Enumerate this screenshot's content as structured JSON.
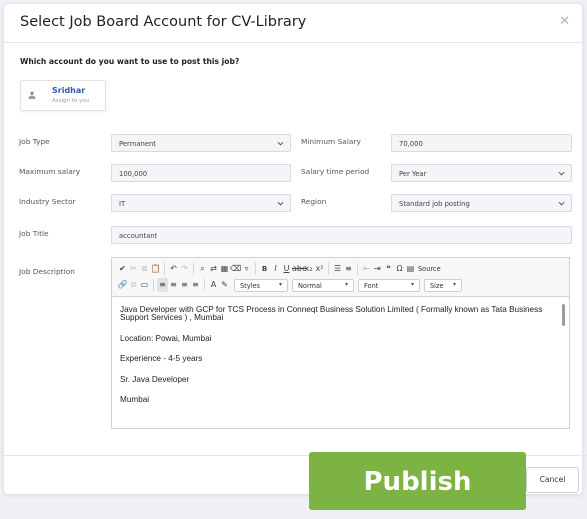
{
  "modal": {
    "title": "Select Job Board Account for CV-Library",
    "close_icon": "close-icon"
  },
  "account_question": "Which account do you want to use to post this job?",
  "account": {
    "name": "Sridhar",
    "subtitle": "Assign to you",
    "icon": "person-icon"
  },
  "form": {
    "job_type": {
      "label": "Job Type",
      "value": "Permanent"
    },
    "minimum_salary": {
      "label": "Minimum Salary",
      "value": "70,000"
    },
    "maximum_salary": {
      "label": "Maximum salary",
      "value": "100,000"
    },
    "salary_time_period": {
      "label": "Salary time period",
      "value": "Per Year"
    },
    "industry_sector": {
      "label": "Industry Sector",
      "value": "IT"
    },
    "region": {
      "label": "Region",
      "value": "Standard job posting"
    },
    "job_title": {
      "label": "Job Title",
      "value": "accountant"
    },
    "job_description": {
      "label": "Job Description"
    }
  },
  "editor": {
    "source_label": "Source",
    "styles_label": "Styles",
    "format_label": "Normal",
    "font_label": "Font",
    "size_label": "Size",
    "paragraphs": [
      "Java Developer with GCP for TCS Process in Conneqt Business Solution Limited ( Formally known as Tata Business Support Services ) , Mumbai",
      "Location: Powai, Mumbai",
      "Experience - 4-5 years",
      "Sr. Java Developer",
      "Mumbai"
    ]
  },
  "buttons": {
    "cancel": "Cancel",
    "publish": "Publish"
  },
  "colors": {
    "publish_bg": "#7cb342",
    "account_name": "#2b5ba8",
    "field_bg": "#f4f5f8"
  }
}
